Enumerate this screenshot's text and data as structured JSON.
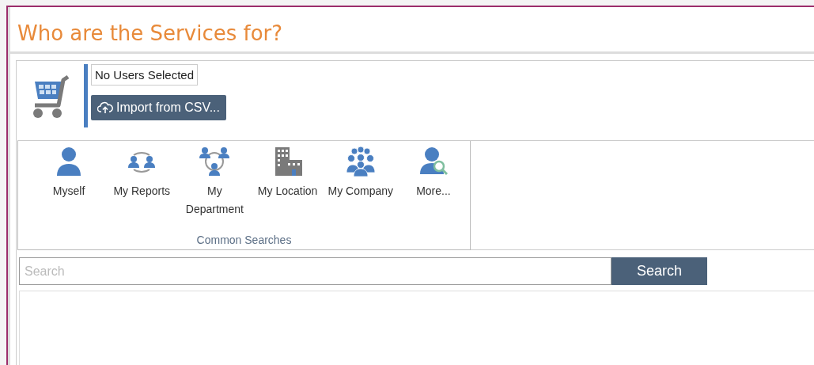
{
  "dialog": {
    "title": "Who are the Services for?"
  },
  "selection": {
    "status": "No Users Selected",
    "import_button": "Import from CSV..."
  },
  "common_searches": {
    "caption": "Common Searches",
    "items": [
      {
        "kind": "person",
        "label": "Myself"
      },
      {
        "kind": "reports",
        "label": "My Reports"
      },
      {
        "kind": "department",
        "label": "My Department"
      },
      {
        "kind": "location",
        "label": "My Location"
      },
      {
        "kind": "company",
        "label": "My Company"
      },
      {
        "kind": "more",
        "label": "More..."
      }
    ]
  },
  "search": {
    "placeholder": "Search",
    "button": "Search"
  }
}
